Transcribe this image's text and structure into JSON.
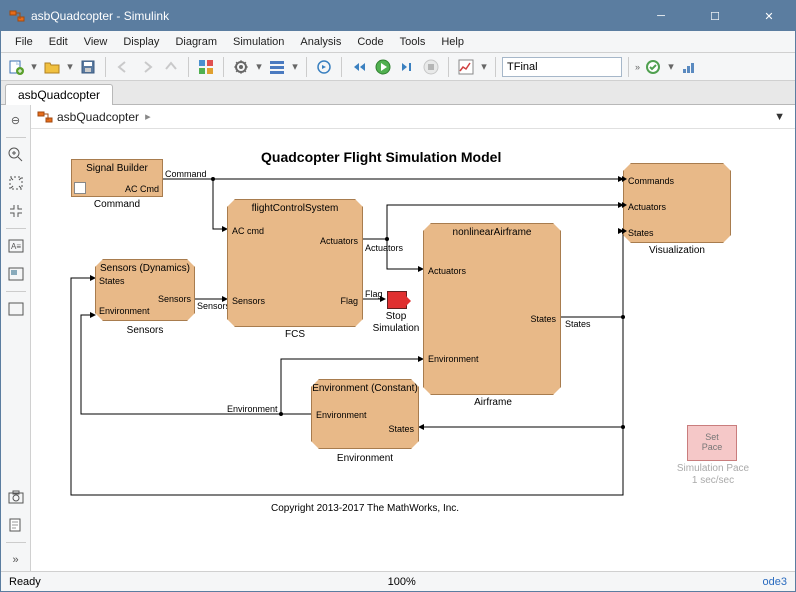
{
  "window": {
    "title": "asbQuadcopter - Simulink",
    "app_icon": "simulink-icon"
  },
  "menu": [
    "File",
    "Edit",
    "View",
    "Display",
    "Diagram",
    "Simulation",
    "Analysis",
    "Code",
    "Tools",
    "Help"
  ],
  "toolbar": {
    "stop_time_field": "TFinal"
  },
  "tabstrip": {
    "tabs": [
      "asbQuadcopter"
    ]
  },
  "breadcrumb": {
    "model": "asbQuadcopter"
  },
  "canvas": {
    "title": "Quadcopter Flight Simulation Model",
    "copyright": "Copyright 2013-2017 The MathWorks, Inc.",
    "blocks": {
      "signal_builder": {
        "name": "Signal Builder",
        "out1": "AC Cmd",
        "label": "Command"
      },
      "sensors": {
        "name": "Sensors (Dynamics)",
        "in1": "States",
        "in2": "Environment",
        "out1": "Sensors",
        "label": "Sensors"
      },
      "fcs": {
        "name": "flightControlSystem",
        "in1": "AC cmd",
        "in2": "Sensors",
        "out1": "Actuators",
        "out2": "Flag",
        "label": "FCS"
      },
      "airframe": {
        "name": "nonlinearAirframe",
        "in1": "Actuators",
        "in2": "Environment",
        "out1": "States",
        "label": "Airframe"
      },
      "environment": {
        "name": "Environment (Constant)",
        "in1": "Environment",
        "out1": "States",
        "label": "Environment"
      },
      "visualization": {
        "in1": "Commands",
        "in2": "Actuators",
        "in3": "States",
        "label": "Visualization"
      },
      "stop": {
        "label1": "Stop",
        "label2": "Simulation"
      },
      "pace": {
        "line1": "Set",
        "line2": "Pace",
        "label1": "Simulation Pace",
        "label2": "1 sec/sec"
      }
    },
    "signals": {
      "command": "Command",
      "sensors": "Sensors",
      "actuators": "Actuators",
      "flag": "Flag",
      "states": "States",
      "environment": "Environment"
    }
  },
  "status": {
    "ready": "Ready",
    "zoom": "100%",
    "solver": "ode3"
  }
}
